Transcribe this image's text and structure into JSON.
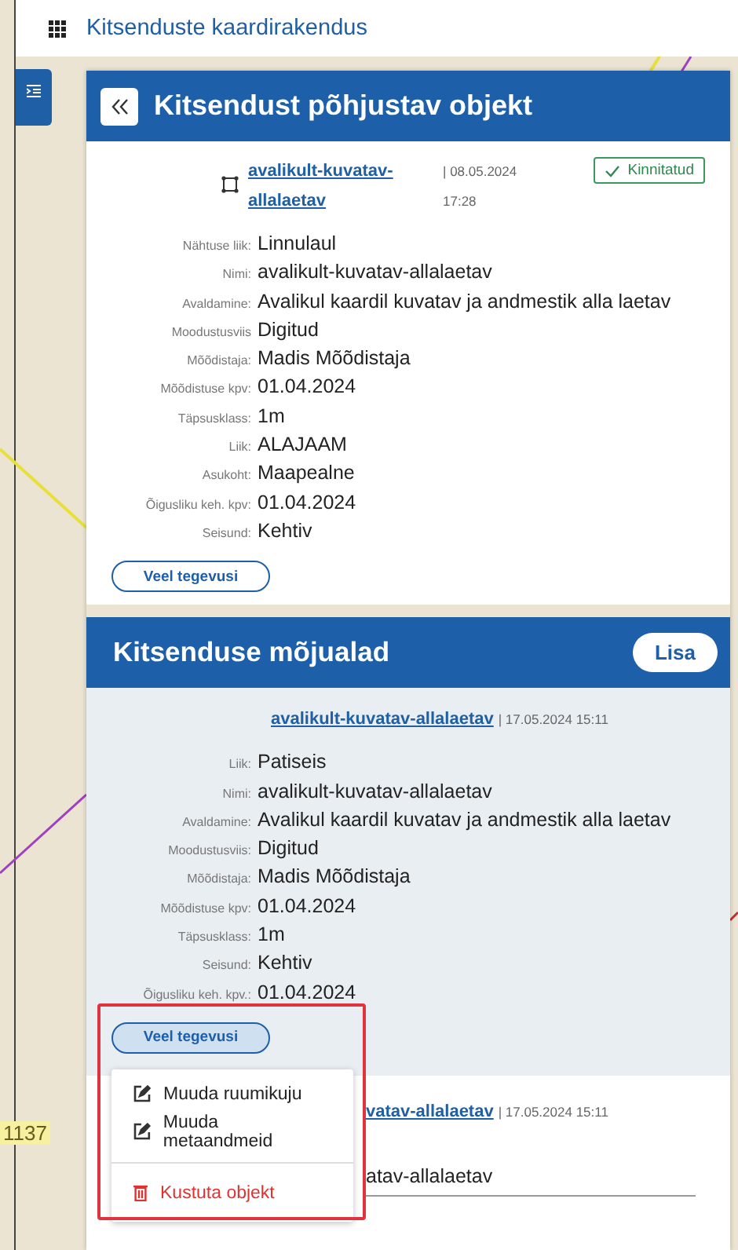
{
  "app_bar": {
    "title": "Kitsenduste kaardirakendus"
  },
  "map": {
    "label": "1137"
  },
  "object_panel": {
    "title": "Kitsendust põhjustav objekt",
    "link": "avalikult-kuvatav-allalaetav",
    "timestamp": "| 08.05.2024 17:28",
    "status": "Kinnitatud",
    "fields": [
      {
        "label": "Nähtuse liik:",
        "value": "Linnulaul"
      },
      {
        "label": "Nimi:",
        "value": "avalikult-kuvatav-allalaetav"
      },
      {
        "label": "Avaldamine:",
        "value": "Avalikul kaardil kuvatav ja andmestik alla laetav"
      },
      {
        "label": "Moodustusviis",
        "value": "Digitud"
      },
      {
        "label": "Mõõdistaja:",
        "value": "Madis Mõõdistaja"
      },
      {
        "label": "Mõõdistuse kpv:",
        "value": "01.04.2024"
      },
      {
        "label": "Täpsusklass:",
        "value": "1m"
      },
      {
        "label": "Liik:",
        "value": "ALAJAAM"
      },
      {
        "label": "Asukoht:",
        "value": "Maapealne"
      },
      {
        "label": "Õigusliku keh. kpv:",
        "value": "01.04.2024"
      },
      {
        "label": "Seisund:",
        "value": "Kehtiv"
      }
    ],
    "action_button": "Veel tegevusi"
  },
  "zones_section": {
    "title": "Kitsenduse mõjualad",
    "add_button": "Lisa",
    "item": {
      "link": "avalikult-kuvatav-allalaetav",
      "timestamp": "| 17.05.2024 15:11",
      "fields": [
        {
          "label": "Liik:",
          "value": "Patiseis"
        },
        {
          "label": "Nimi:",
          "value": "avalikult-kuvatav-allalaetav"
        },
        {
          "label": "Avaldamine:",
          "value": "Avalikul kaardil kuvatav ja andmestik alla laetav"
        },
        {
          "label": "Moodustusviis:",
          "value": "Digitud"
        },
        {
          "label": "Mõõdistaja:",
          "value": "Madis Mõõdistaja"
        },
        {
          "label": "Mõõdistuse kpv:",
          "value": "01.04.2024"
        },
        {
          "label": "Täpsusklass:",
          "value": "1m"
        },
        {
          "label": "Seisund:",
          "value": "Kehtiv"
        },
        {
          "label": "Õigusliku keh. kpv.:",
          "value": "01.04.2024"
        }
      ],
      "action_button": "Veel tegevusi",
      "menu_open": true,
      "menu": [
        {
          "label": "Muuda ruumikuju",
          "kind": "edit"
        },
        {
          "label": "Muuda metaandmeid",
          "kind": "edit"
        },
        {
          "label": "Kustuta objekt",
          "kind": "delete"
        }
      ]
    },
    "partial_item": {
      "link": "vatav-allalaetav",
      "timestamp": "| 17.05.2024 15:11",
      "value": "atav-allalaetav"
    }
  }
}
